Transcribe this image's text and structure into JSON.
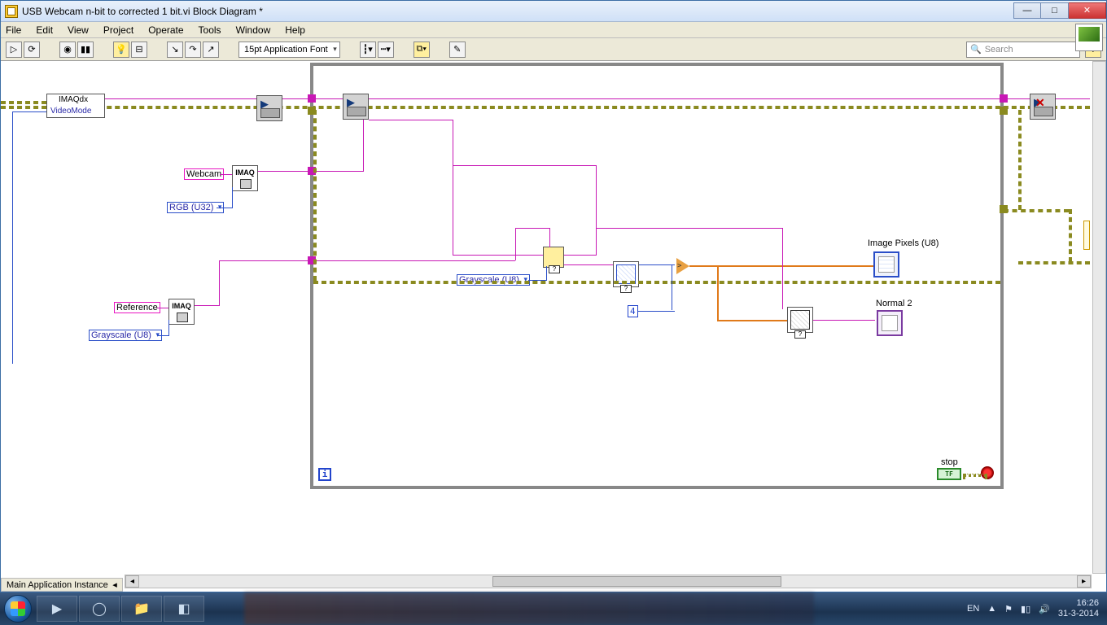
{
  "window": {
    "title": "USB Webcam n-bit to corrected 1 bit.vi Block Diagram *"
  },
  "menu": {
    "file": "File",
    "edit": "Edit",
    "view": "View",
    "project": "Project",
    "operate": "Operate",
    "tools": "Tools",
    "window": "Window",
    "help": "Help"
  },
  "toolbar": {
    "font": "15pt Application Font",
    "search_placeholder": "Search"
  },
  "diagram": {
    "express": {
      "line1": "IMAQdx",
      "line2": "VideoMode"
    },
    "webcam_label": "Webcam",
    "rgb_sel": "RGB (U32)",
    "reference_label": "Reference",
    "gray_sel_1": "Grayscale (U8)",
    "gray_sel_2": "Grayscale (U8)",
    "const4": "4",
    "img_pixels": "Image Pixels (U8)",
    "normal2": "Normal 2",
    "stop_label": "stop",
    "stop_tf": "TF",
    "imaq": "IMAQ",
    "iter": "i"
  },
  "status": {
    "context": "Main Application Instance"
  },
  "taskbar": {
    "lang": "EN",
    "time": "16:26",
    "date": "31-3-2014"
  }
}
